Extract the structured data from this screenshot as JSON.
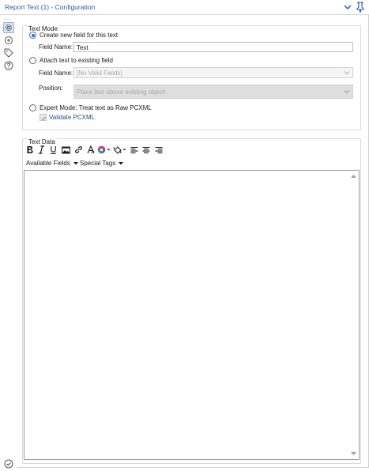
{
  "window": {
    "title": "Report Text (1) - Configuration"
  },
  "text_mode": {
    "group_title": "Text Mode",
    "create_new_field_label": "Create new field for this text",
    "field_name_label": "Field Name:",
    "field_name_value": "Text",
    "attach_text_label": "Attach text to existing field",
    "attach_field_name_label": "Field Name:",
    "attach_field_name_value": "[No Valid Fields]",
    "position_label": "Position:",
    "position_value": "Place text above existing object",
    "expert_mode_label": "Expert Mode: Treat text as Raw PCXML",
    "validate_label": "Validate PCXML",
    "selected_mode": "create_new_field"
  },
  "text_data": {
    "group_title": "Text Data",
    "toolbar": [
      {
        "icon": "bold-icon"
      },
      {
        "icon": "italic-icon"
      },
      {
        "icon": "underline-icon"
      },
      {
        "icon": "image-icon"
      },
      {
        "icon": "link-icon"
      },
      {
        "icon": "font-icon"
      },
      {
        "icon": "color-icon"
      },
      {
        "icon": "highlight-icon"
      },
      {
        "icon": "align-left-icon"
      },
      {
        "icon": "align-center-icon"
      },
      {
        "icon": "align-right-icon"
      }
    ],
    "available_fields_label": "Available Fields",
    "special_tags_label": "Special Tags",
    "editor_content": ""
  },
  "colors": {
    "accent": "#2f6fca",
    "title_text": "#2a5ba8"
  }
}
